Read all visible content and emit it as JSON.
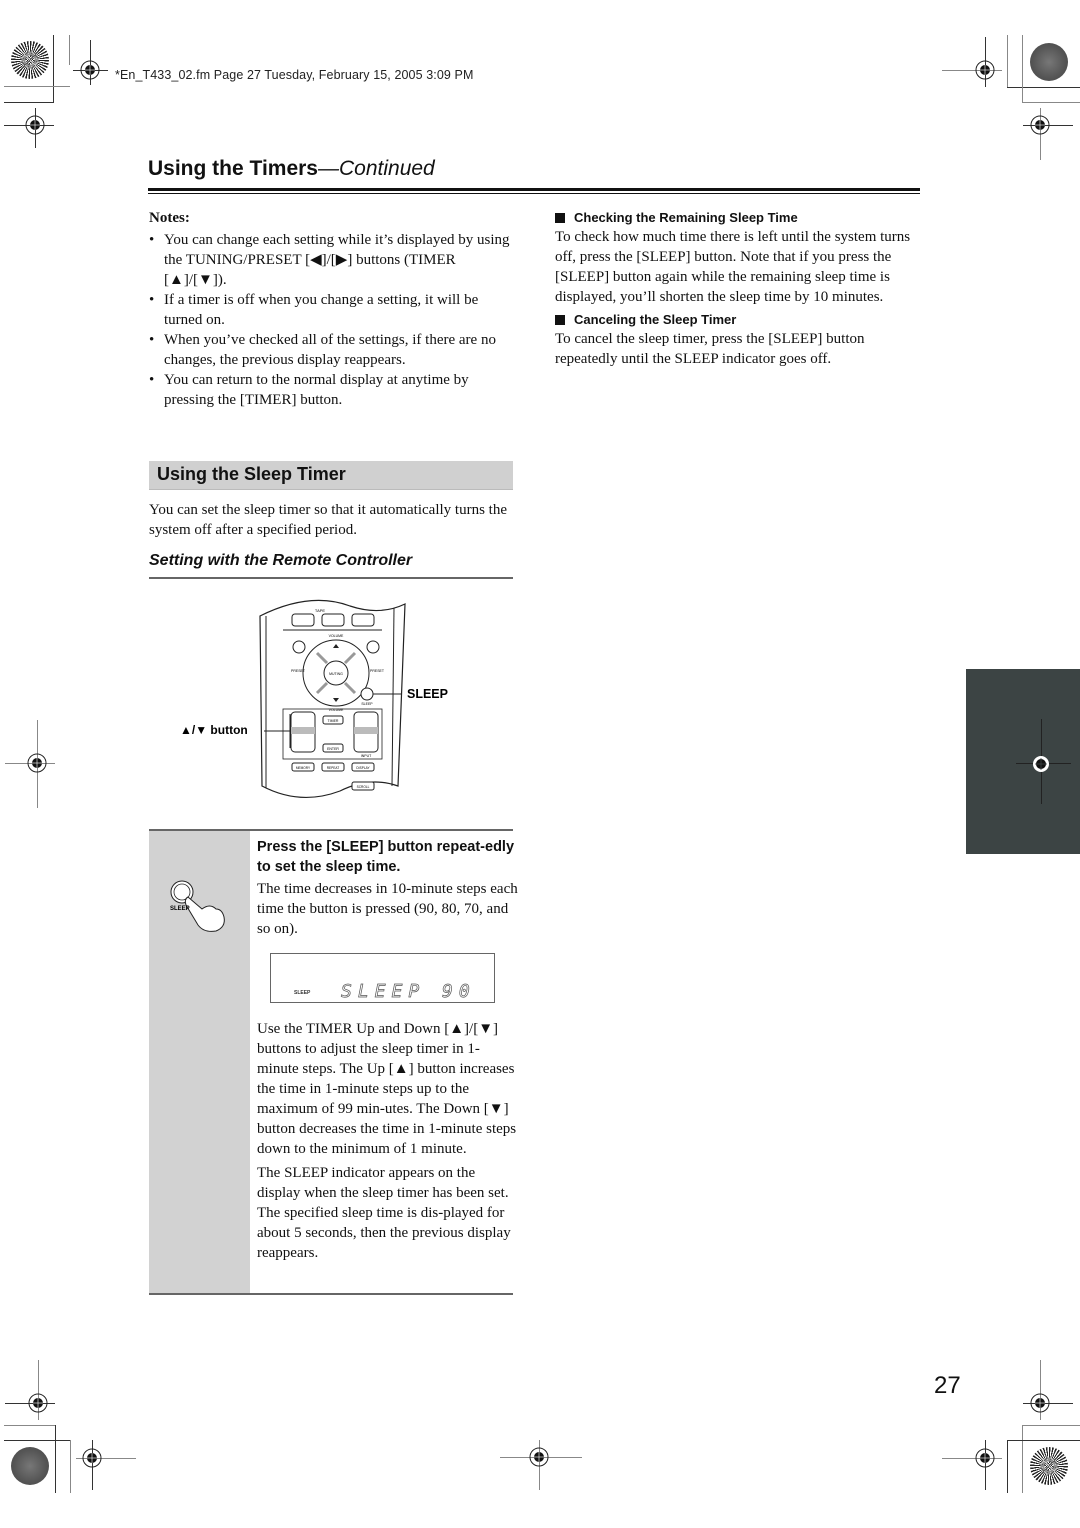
{
  "file_header": "*En_T433_02.fm  Page 27  Tuesday, February 15, 2005  3:09 PM",
  "page_title": {
    "main": "Using the Timers",
    "continued": "—Continued"
  },
  "notes": {
    "heading": "Notes:",
    "items": [
      "You can change each setting while it’s displayed by using the TUNING/PRESET [◀]/[▶] buttons (TIMER [▲]/[▼]).",
      "If a timer is off when you change a setting, it will be turned on.",
      "When you’ve checked all of the settings, if there are no changes, the previous display reappears.",
      "You can return to the normal display at anytime by pressing the [TIMER] button."
    ]
  },
  "right_column": {
    "sections": [
      {
        "heading": "Checking the Remaining Sleep Time",
        "body": "To check how much time there is left until the system turns off, press the [SLEEP] button. Note that if you press the [SLEEP] button again while the remaining sleep time is displayed, you’ll shorten the sleep time by 10 minutes."
      },
      {
        "heading": "Canceling the Sleep Timer",
        "body": "To cancel the sleep timer, press the [SLEEP] button repeatedly until the SLEEP indicator goes off."
      }
    ]
  },
  "section": {
    "title": "Using the Sleep Timer",
    "intro": "You can set the sleep timer so that it automatically turns the system off after a specified period.",
    "subtitle": "Setting with the Remote Controller"
  },
  "remote_figure": {
    "callout_sleep": "SLEEP",
    "callout_updown": "▲/▼ button",
    "labels": {
      "tape": "TAPE",
      "volume_top": "VOLUME",
      "volume_bottom": "VOLUME",
      "preset_left": "PRESET",
      "preset_right": "PRESET",
      "muting": "MUTING",
      "sleep": "SLEEP",
      "timer": "TIMER",
      "enter": "ENTER",
      "input": "INPUT",
      "memory": "MEMORY",
      "repeat": "REPEAT",
      "display": "DISPLAY",
      "scroll": "SCROLL"
    }
  },
  "step": {
    "icon_label": "SLEEP",
    "heading": "Press the [SLEEP] button repeat-edly to set the sleep time.",
    "body1": "The time decreases in 10-minute steps each time the button is pressed (90, 80, 70, and so on).",
    "lcd": {
      "indicator": "SLEEP",
      "text": "SLEEP 90"
    },
    "body2": "Use the TIMER Up and Down [▲]/[▼] buttons to adjust the sleep timer in 1-minute steps. The Up [▲] button increases the time in 1-minute steps up to the maximum of 99 min-utes. The Down [▼] button decreases the time in 1-minute steps down to the minimum of 1 minute.",
    "body3": "The SLEEP indicator appears on the display when the sleep timer has been set. The specified sleep time is dis-played for about 5 seconds, then the previous display reappears."
  },
  "page_number": "27"
}
